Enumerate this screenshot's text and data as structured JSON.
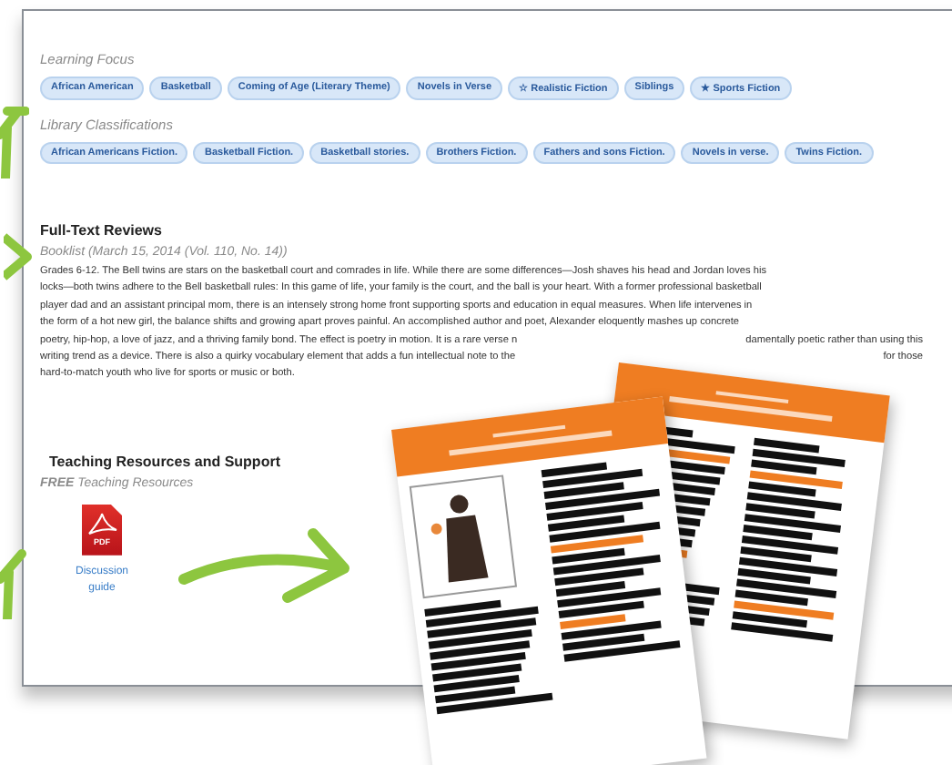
{
  "learning_focus": {
    "heading": "Learning Focus",
    "tags": [
      {
        "label": "African American"
      },
      {
        "label": "Basketball"
      },
      {
        "label": "Coming of Age (Literary Theme)"
      },
      {
        "label": "Novels in Verse"
      },
      {
        "label": "☆ Realistic Fiction"
      },
      {
        "label": "Siblings"
      },
      {
        "label": "★ Sports Fiction"
      }
    ]
  },
  "library_classifications": {
    "heading": "Library Classifications",
    "tags": [
      {
        "label": "African Americans Fiction."
      },
      {
        "label": "Basketball Fiction."
      },
      {
        "label": "Basketball stories."
      },
      {
        "label": "Brothers Fiction."
      },
      {
        "label": "Fathers and sons Fiction."
      },
      {
        "label": "Novels in verse."
      },
      {
        "label": "Twins Fiction."
      }
    ]
  },
  "reviews": {
    "heading": "Full-Text Reviews",
    "source": "Booklist (March 15, 2014 (Vol. 110, No. 14))",
    "lines": [
      [
        "Grades 6-12. The Bell twins are stars on the basketball court and comrades in life. While there are some differences—Josh shaves his head and Jordan loves his"
      ],
      [
        "locks—both twins adhere to the Bell basketball rules: In this game of life, your family is the court, and the ball is your heart. With a former professional basketball"
      ],
      [
        "player dad and an assistant principal mom, there is an intensely strong home front supporting sports and education in equal measures. When life intervenes in"
      ],
      [
        "the form of a hot new girl, the balance shifts and growing apart proves painful. An accomplished author and poet, Alexander eloquently mashes up concrete"
      ],
      [
        "poetry, hip-hop, a love of jazz, and a thriving family bond. The effect is poetry in motion. It is a rare verse n",
        "damentally poetic rather than using this"
      ],
      [
        "writing trend as a device. There is also a quirky vocabulary element that adds a fun intellectual note to the",
        "for those"
      ],
      [
        "hard-to-match youth who live for sports or music or both."
      ]
    ]
  },
  "teaching_resources": {
    "heading": "Teaching Resources and Support",
    "subheading": "**FREE** Teaching Resources",
    "files": [
      {
        "badge": "PDF",
        "label": "Discussion guide"
      }
    ]
  }
}
